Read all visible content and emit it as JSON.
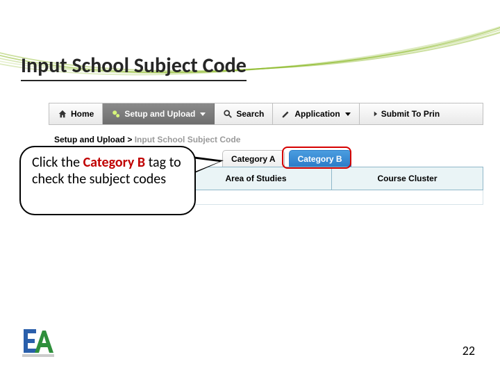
{
  "slide": {
    "title": "Input School Subject Code",
    "page_number": "22"
  },
  "nav": {
    "home": "Home",
    "setup_upload": "Setup and Upload",
    "search": "Search",
    "application": "Application",
    "submit_to_print": "Submit To Prin"
  },
  "breadcrumb": {
    "parent": "Setup and Upload",
    "sep": ">",
    "current": "Input School Subject Code"
  },
  "tabs": {
    "category_a": "Category A",
    "category_b": "Category B"
  },
  "table": {
    "col_area": "Area of Studies",
    "col_cluster": "Course Cluster"
  },
  "callout": {
    "pre": "Click the ",
    "em": "Category B",
    "post": " tag to check the subject codes"
  }
}
